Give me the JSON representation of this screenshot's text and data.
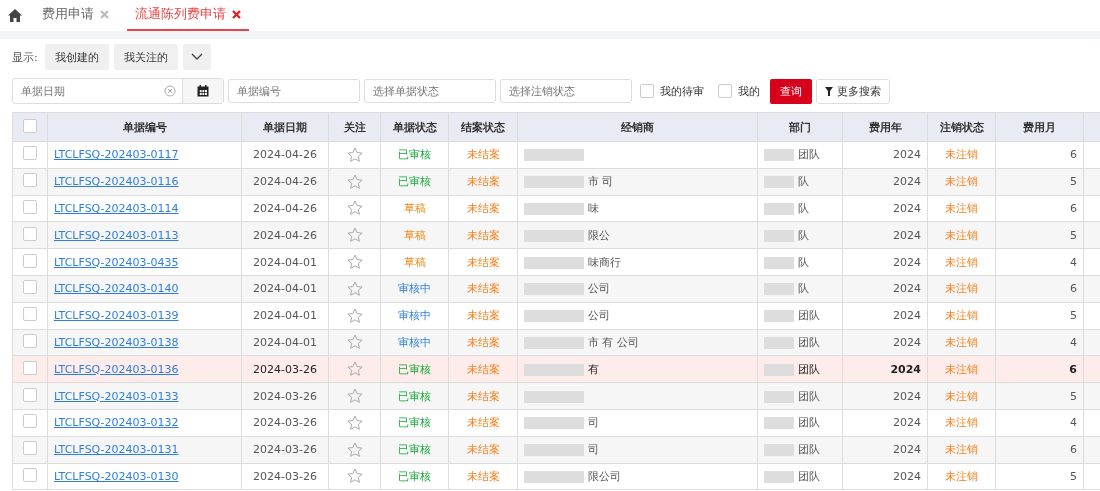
{
  "tabs": [
    {
      "label": "费用申请",
      "selected": false
    },
    {
      "label": "流通陈列费申请",
      "selected": true
    }
  ],
  "display": {
    "label": "显示:",
    "options": [
      {
        "label": "我创建的"
      },
      {
        "label": "我关注的"
      }
    ]
  },
  "filters": {
    "date": {
      "placeholder": "单据日期"
    },
    "number": {
      "placeholder": "单据编号"
    },
    "doc_status": {
      "placeholder": "选择单据状态"
    },
    "cancel_status": {
      "placeholder": "选择注销状态"
    },
    "checks": [
      {
        "label": "我的待审",
        "checked": false
      },
      {
        "label": "我的",
        "checked": false
      }
    ],
    "query_button": "查询",
    "more_button": "更多搜索"
  },
  "table": {
    "all_checked": false,
    "columns": [
      "单据编号",
      "单据日期",
      "关注",
      "单据状态",
      "结案状态",
      "经销商",
      "部门",
      "费用年",
      "注销状态",
      "费用月"
    ],
    "rows": [
      {
        "selected": false,
        "checked": false,
        "starred": false,
        "number": "LTCLFSQ-202403-0117",
        "date": "2024-04-26",
        "status": {
          "text": "已审核",
          "kind": "approved"
        },
        "close": "未结案",
        "dept": "团队",
        "year": "2024",
        "cancel": "未注销",
        "month": "6"
      },
      {
        "selected": false,
        "checked": false,
        "starred": false,
        "number": "LTCLFSQ-202403-0116",
        "date": "2024-04-26",
        "status": {
          "text": "已审核",
          "kind": "approved"
        },
        "close": "未结案",
        "dealer": "市 司",
        "dept": "队",
        "year": "2024",
        "cancel": "未注销",
        "month": "5"
      },
      {
        "selected": false,
        "checked": false,
        "starred": false,
        "number": "LTCLFSQ-202403-0114",
        "date": "2024-04-26",
        "status": {
          "text": "草稿",
          "kind": "draft"
        },
        "close": "未结案",
        "dealer": "味",
        "dept": "队",
        "year": "2024",
        "cancel": "未注销",
        "month": "6"
      },
      {
        "selected": false,
        "checked": false,
        "starred": false,
        "number": "LTCLFSQ-202403-0113",
        "date": "2024-04-26",
        "status": {
          "text": "草稿",
          "kind": "draft"
        },
        "close": "未结案",
        "dealer": "限公",
        "dept": "队",
        "year": "2024",
        "cancel": "未注销",
        "month": "5"
      },
      {
        "selected": false,
        "checked": false,
        "starred": false,
        "number": "LTCLFSQ-202403-0435",
        "date": "2024-04-01",
        "status": {
          "text": "草稿",
          "kind": "draft"
        },
        "close": "未结案",
        "dealer": "味商行",
        "dept": "队",
        "year": "2024",
        "cancel": "未注销",
        "month": "4"
      },
      {
        "selected": false,
        "checked": false,
        "starred": false,
        "number": "LTCLFSQ-202403-0140",
        "date": "2024-04-01",
        "status": {
          "text": "审核中",
          "kind": "reviewing"
        },
        "close": "未结案",
        "dealer": "公司",
        "dept": "队",
        "year": "2024",
        "cancel": "未注销",
        "month": "6"
      },
      {
        "selected": false,
        "checked": false,
        "starred": false,
        "number": "LTCLFSQ-202403-0139",
        "date": "2024-04-01",
        "status": {
          "text": "审核中",
          "kind": "reviewing"
        },
        "close": "未结案",
        "dealer": "公司",
        "dept": "团队",
        "year": "2024",
        "cancel": "未注销",
        "month": "5"
      },
      {
        "selected": false,
        "checked": false,
        "starred": false,
        "number": "LTCLFSQ-202403-0138",
        "date": "2024-04-01",
        "status": {
          "text": "审核中",
          "kind": "reviewing"
        },
        "close": "未结案",
        "dealer": "市 有 公司",
        "dept": "团队",
        "year": "2024",
        "cancel": "未注销",
        "month": "4"
      },
      {
        "selected": true,
        "checked": false,
        "starred": false,
        "number": "LTCLFSQ-202403-0136",
        "date": "2024-03-26",
        "status": {
          "text": "已审核",
          "kind": "approved"
        },
        "close": "未结案",
        "dealer": "有",
        "dept": "团队",
        "year": "2024",
        "cancel": "未注销",
        "month": "6"
      },
      {
        "selected": false,
        "checked": false,
        "starred": false,
        "number": "LTCLFSQ-202403-0133",
        "date": "2024-03-26",
        "status": {
          "text": "已审核",
          "kind": "approved"
        },
        "close": "未结案",
        "dept": "团队",
        "year": "2024",
        "cancel": "未注销",
        "month": "5"
      },
      {
        "selected": false,
        "checked": false,
        "starred": false,
        "number": "LTCLFSQ-202403-0132",
        "date": "2024-03-26",
        "status": {
          "text": "已审核",
          "kind": "approved"
        },
        "close": "未结案",
        "dealer": "司",
        "dept": "团队",
        "year": "2024",
        "cancel": "未注销",
        "month": "4"
      },
      {
        "selected": false,
        "checked": false,
        "starred": false,
        "number": "LTCLFSQ-202403-0131",
        "date": "2024-03-26",
        "status": {
          "text": "已审核",
          "kind": "approved"
        },
        "close": "未结案",
        "dealer": "司",
        "dept": "团队",
        "year": "2024",
        "cancel": "未注销",
        "month": "6"
      },
      {
        "selected": false,
        "checked": false,
        "starred": false,
        "number": "LTCLFSQ-202403-0130",
        "date": "2024-03-26",
        "status": {
          "text": "已审核",
          "kind": "approved"
        },
        "close": "未结案",
        "dealer": "限公司",
        "dept": "团队",
        "year": "2024",
        "cancel": "未注销",
        "month": "5"
      }
    ]
  }
}
